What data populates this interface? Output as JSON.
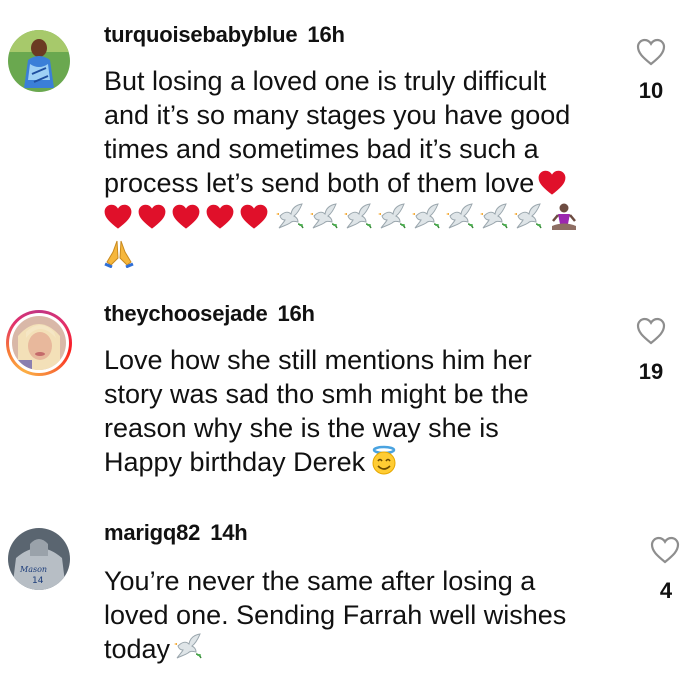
{
  "comments": [
    {
      "username": "turquoisebabyblue",
      "time": "16h",
      "lines": [
        "But losing a loved one is truly difficult",
        "and it’s so many stages you have good",
        "times and sometimes bad it’s such a",
        "process let’s send both of them love"
      ],
      "likes": "10",
      "emojis": [
        "red-heart",
        "red-heart",
        "red-heart",
        "red-heart",
        "red-heart",
        "dove",
        "dove",
        "dove",
        "dove",
        "dove",
        "dove",
        "dove",
        "dove",
        "person-in-lotus",
        "folded-hands"
      ]
    },
    {
      "username": "theychoosejade",
      "time": "16h",
      "lines": [
        "Love how she still mentions him her",
        "story was sad tho smh might be the",
        "reason why she is the way she is",
        "Happy birthday Derek"
      ],
      "likes": "19",
      "emojis": [
        "smiling-face-with-halo"
      ]
    },
    {
      "username": "marigq82",
      "time": "14h",
      "lines": [
        "You’re never the same after losing a",
        "loved one. Sending Farrah well wishes",
        "today"
      ],
      "likes": "4",
      "emojis": [
        "dove"
      ]
    }
  ],
  "colors": {
    "text": "#111111",
    "icon": "#8e8e8e",
    "heart": "#e0102a",
    "ring": "#e1306c"
  },
  "icons": {
    "like": "heart-outline-icon"
  }
}
